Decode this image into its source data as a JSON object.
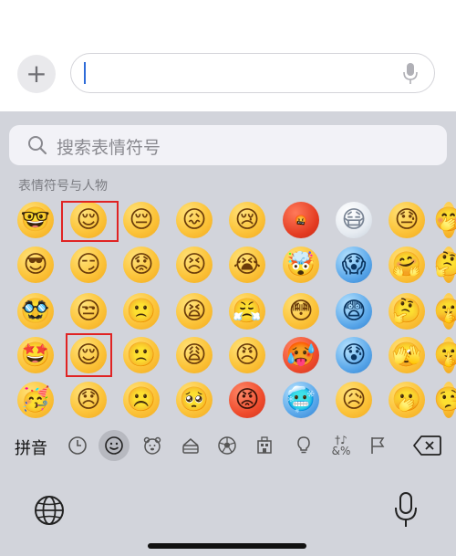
{
  "input_bar": {
    "add_button_label": "+",
    "text_value": ""
  },
  "search": {
    "placeholder": "搜索表情符号"
  },
  "section": {
    "label": "表情符号与人物"
  },
  "emoji_rows": [
    [
      "🤓",
      "😌",
      "😔",
      "😖",
      "😢",
      "🤬",
      "😷",
      "😓",
      "🤭"
    ],
    [
      "😎",
      "😏",
      "😟",
      "😣",
      "😭",
      "🤯",
      "😱",
      "🤗",
      "🤔"
    ],
    [
      "🥸",
      "😒",
      "🙁",
      "😫",
      "😤",
      "😳",
      "😨",
      "🤔",
      "🤫"
    ],
    [
      "🤩",
      "😌",
      "🙁",
      "😩",
      "😠",
      "🥵",
      "😰",
      "🫣",
      "🤫"
    ],
    [
      "🥳",
      "😞",
      "☹️",
      "🥺",
      "😡",
      "🥶",
      "😥",
      "🫢",
      "🤥"
    ]
  ],
  "categories": {
    "label": "拼音",
    "icons": [
      "clock-icon",
      "smiley-icon",
      "animal-icon",
      "food-icon",
      "soccer-ball-icon",
      "building-icon",
      "lightbulb-icon",
      "symbols-icon",
      "flag-icon"
    ],
    "symbols_text": "†♪&%"
  },
  "colors": {
    "keyboard_bg": "#d2d4db",
    "highlight": "#e02323",
    "caret": "#2e6bd8"
  }
}
